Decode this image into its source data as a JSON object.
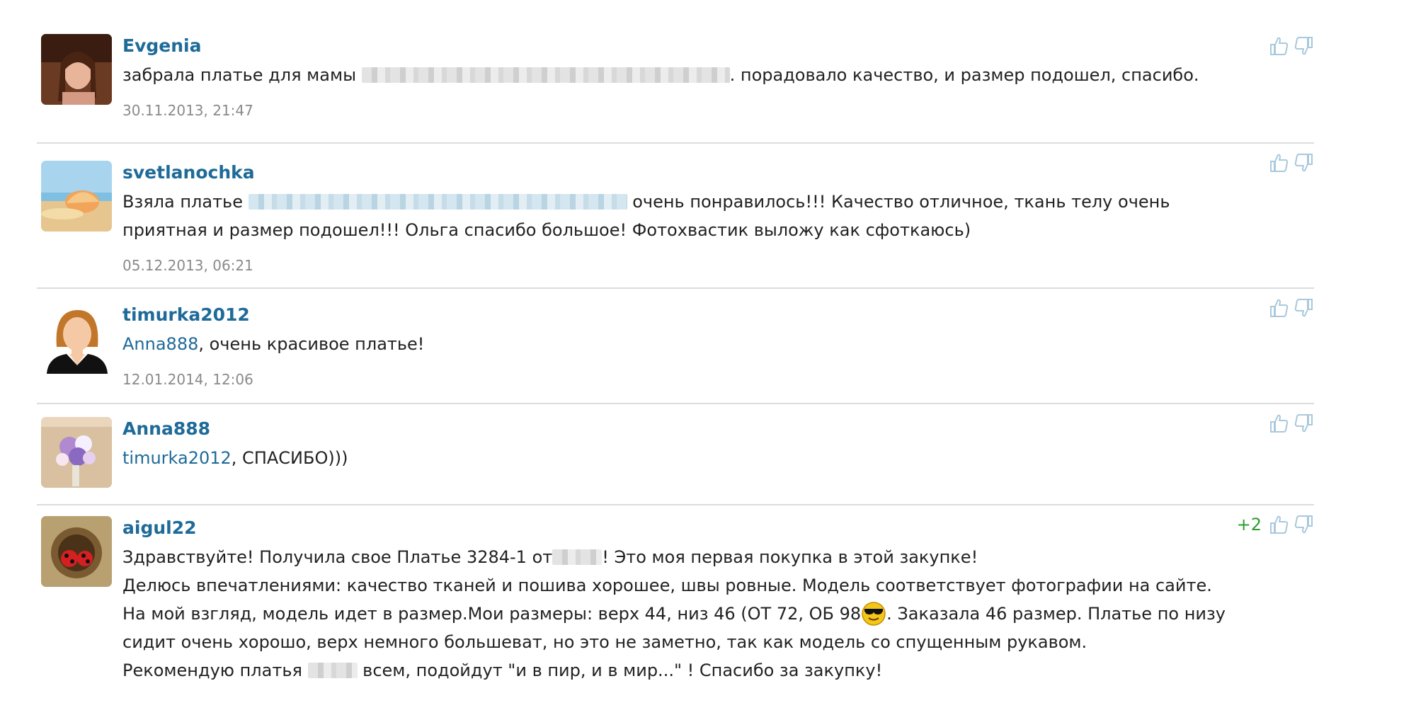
{
  "comments": [
    {
      "author": "Evgenia",
      "segments": [
        {
          "type": "text",
          "value": "забрала платье для мамы "
        },
        {
          "type": "blur",
          "width": 520
        },
        {
          "type": "text",
          "value": ". порадовало качество, и размер подошел, спасибо."
        }
      ],
      "date": "30.11.2013, 21:47",
      "score": "",
      "avatar": "woman-photo"
    },
    {
      "author": "svetlanochka",
      "segments": [
        {
          "type": "text",
          "value": "Взяла платье "
        },
        {
          "type": "blur-blue",
          "width": 535
        },
        {
          "type": "text",
          "value": " очень понравилось!!! Качество отличное, ткань телу очень приятная и размер подошел!!! Ольга спасибо большое! Фотохвастик выложу как сфоткаюсь)"
        }
      ],
      "date": "05.12.2013, 06:21",
      "score": "",
      "avatar": "seashell-photo"
    },
    {
      "author": "timurka2012",
      "segments": [
        {
          "type": "mention",
          "value": "Anna888"
        },
        {
          "type": "text",
          "value": ", очень красивое платье!"
        }
      ],
      "date": "12.01.2014, 12:06",
      "score": "",
      "avatar": "woman-silhouette"
    },
    {
      "author": "Anna888",
      "segments": [
        {
          "type": "mention",
          "value": "timurka2012"
        },
        {
          "type": "text",
          "value": ", СПАСИБО)))"
        }
      ],
      "date": "",
      "score": "",
      "avatar": "flowers-photo"
    },
    {
      "author": "aigul22",
      "segments": [
        {
          "type": "text",
          "value": "Здравствуйте! Получила свое Платье 3284-1 от"
        },
        {
          "type": "blur",
          "width": 70
        },
        {
          "type": "text",
          "value": "! Это моя первая покупка в этой закупке!"
        },
        {
          "type": "br"
        },
        {
          "type": "text",
          "value": "Делюсь впечатлениями: качество тканей и пошива хорошее, швы ровные. Модель соответствует фотографии на сайте."
        },
        {
          "type": "br"
        },
        {
          "type": "text",
          "value": "На мой взгляд, модель идет в размер.Мои размеры: верх 44, низ 46 (ОТ 72, ОБ 98"
        },
        {
          "type": "emoji",
          "value": "cool-smiley"
        },
        {
          "type": "text",
          "value": ". Заказала 46 размер. Платье по низу сидит очень хорошо, верх немного большеват, но это не заметно, так как модель со спущенным рукавом."
        },
        {
          "type": "br"
        },
        {
          "type": "text",
          "value": "Рекомендую платья "
        },
        {
          "type": "blur",
          "width": 70
        },
        {
          "type": "text",
          "value": " всем, подойдут \"и в пир, и в мир...\" ! Спасибо за закупку!"
        }
      ],
      "date": "",
      "score": "+2",
      "avatar": "ladybugs-photo"
    }
  ],
  "icons": {
    "like": "thumbs-up-icon",
    "dislike": "thumbs-down-icon"
  },
  "colors": {
    "author": "#1e6a98",
    "icon": "#a9c9dc",
    "score_positive": "#2e9d2e",
    "date": "#8a8a8a"
  }
}
